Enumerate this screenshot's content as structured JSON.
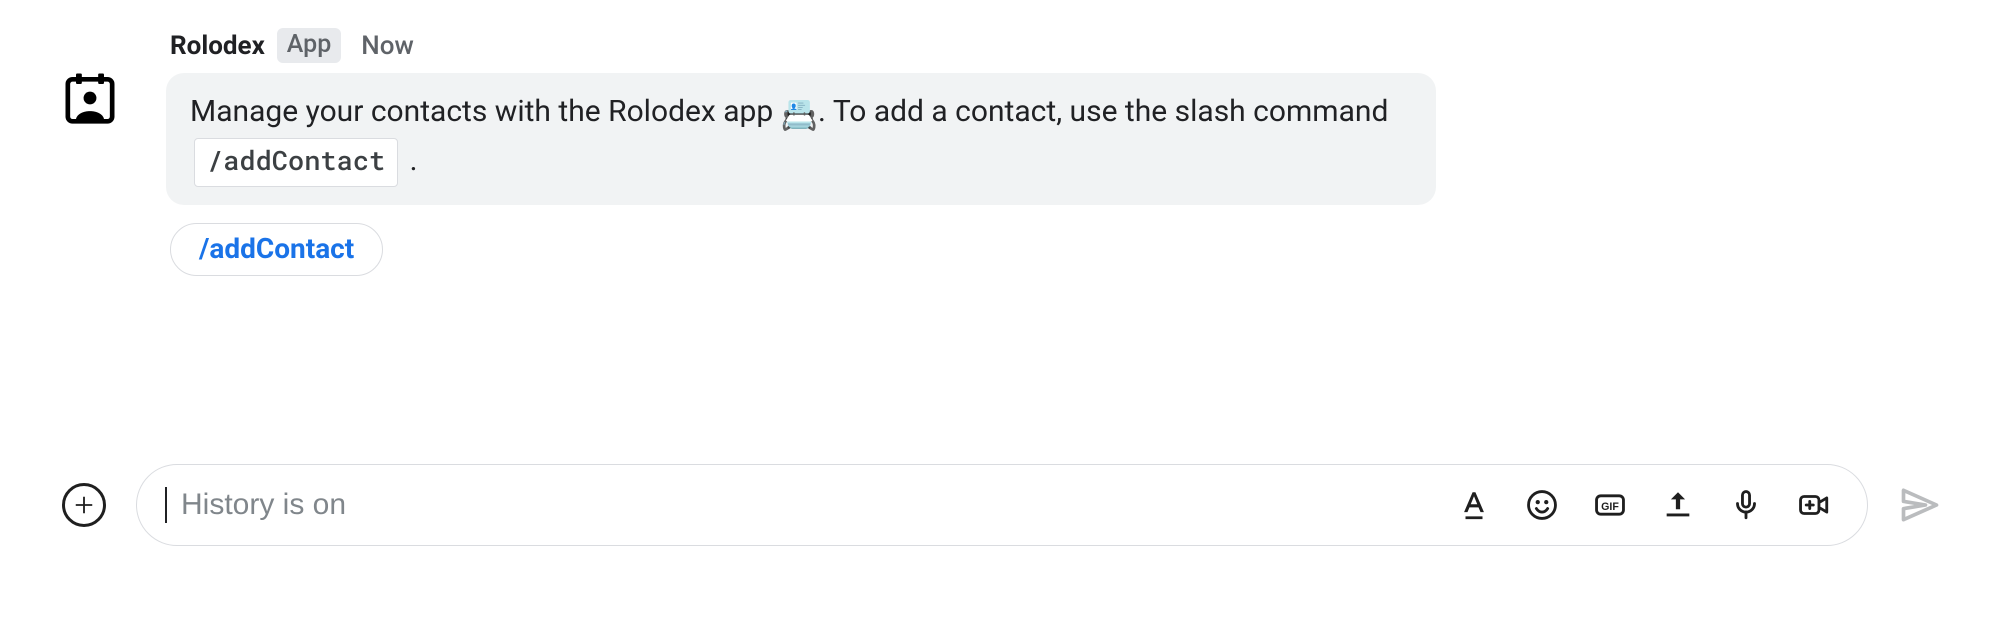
{
  "message": {
    "sender_name": "Rolodex",
    "app_badge": "App",
    "timestamp": "Now",
    "body_pre": "Manage your contacts with the Rolodex app ",
    "body_emoji": "📇",
    "body_mid": ". To add a contact, use the slash command ",
    "slash_command": "/addContact",
    "body_post": " ."
  },
  "suggestion": {
    "label": "/addContact"
  },
  "compose": {
    "placeholder": "History is on"
  }
}
